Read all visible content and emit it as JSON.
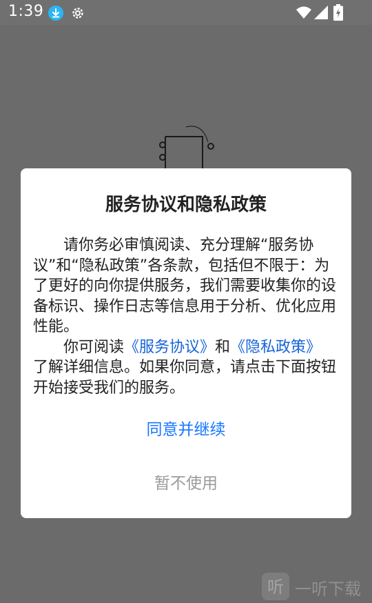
{
  "status_bar": {
    "time": "1:39",
    "icons": [
      "download-icon",
      "settings-icon",
      "wifi-icon",
      "signal-icon",
      "battery-icon"
    ]
  },
  "dialog": {
    "title": "服务协议和隐私政策",
    "paragraph1": "请你务必审慎阅读、充分理解“服务协议”和“隐私政策”各条款，包括但不限于：为了更好的向你提供服务，我们需要收集你的设备标识、操作日志等信息用于分析、优化应用性能。",
    "paragraph2_prefix": "你可阅读",
    "link_service": "《服务协议》",
    "paragraph2_and": "和",
    "link_privacy": "《隐私政策》",
    "paragraph2_suffix": "了解详细信息。如果你同意，请点击下面按钮开始接受我们的服务。",
    "agree_label": "同意并继续",
    "decline_label": "暂不使用"
  },
  "watermark": {
    "logo_char": "听",
    "text": "一听下载"
  },
  "colors": {
    "overlay": "#6b6b6b",
    "link": "#1664d6",
    "agree": "#1677ff",
    "decline": "#9a9a9a"
  }
}
